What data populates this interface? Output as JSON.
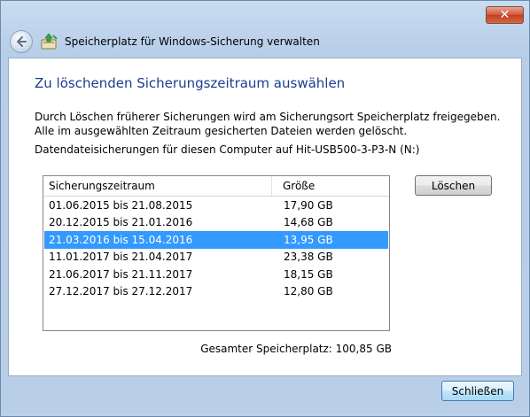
{
  "window": {
    "title": "Speicherplatz für Windows-Sicherung verwalten",
    "close_symbol": "✕"
  },
  "page": {
    "heading": "Zu löschenden Sicherungszeitraum auswählen",
    "description": "Durch Löschen früherer Sicherungen wird am Sicherungsort Speicherplatz freigegeben. Alle im ausgewählten Zeitraum gesicherten Dateien werden gelöscht.",
    "target": "Datendateisicherungen für diesen Computer auf Hit-USB500-3-P3-N (N:)"
  },
  "table": {
    "columns": [
      "Sicherungszeitraum",
      "Größe"
    ],
    "rows": [
      {
        "period": "01.06.2015 bis 21.08.2015",
        "size": "17,90 GB",
        "selected": false
      },
      {
        "period": "20.12.2015 bis 21.01.2016",
        "size": "14,68 GB",
        "selected": false
      },
      {
        "period": "21.03.2016 bis 15.04.2016",
        "size": "13,95 GB",
        "selected": true
      },
      {
        "period": "11.01.2017 bis 21.04.2017",
        "size": "23,38 GB",
        "selected": false
      },
      {
        "period": "21.06.2017 bis 21.11.2017",
        "size": "18,15 GB",
        "selected": false
      },
      {
        "period": "27.12.2017 bis 27.12.2017",
        "size": "12,80 GB",
        "selected": false
      }
    ]
  },
  "buttons": {
    "delete": "Löschen",
    "close": "Schließen"
  },
  "summary": {
    "total": "Gesamter Speicherplatz: 100,85 GB"
  },
  "colors": {
    "accent": "#3399ff",
    "heading": "#1a3d8f"
  }
}
